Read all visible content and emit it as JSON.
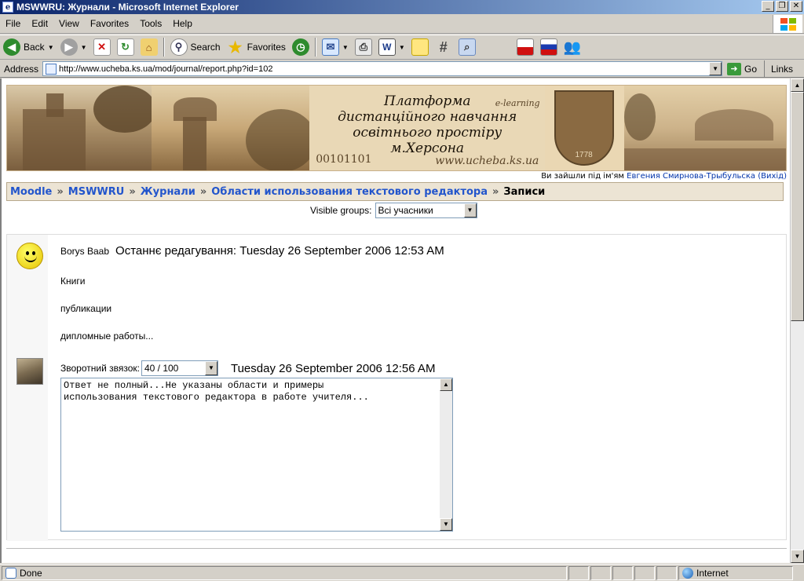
{
  "window": {
    "title": "MSWWRU: Журнали - Microsoft Internet Explorer"
  },
  "menu": [
    "File",
    "Edit",
    "View",
    "Favorites",
    "Tools",
    "Help"
  ],
  "toolbar": {
    "back_label": "Back",
    "search_label": "Search",
    "favorites_label": "Favorites"
  },
  "address": {
    "label": "Address",
    "url": "http://www.ucheba.ks.ua/mod/journal/report.php?id=102",
    "go_label": "Go",
    "links_label": "Links"
  },
  "banner": {
    "title_lines": [
      "Платформа",
      "дистанційного навчання",
      "освітнього простіру",
      "м.Херсона"
    ],
    "binary_text": "00101101",
    "url_text": "www.ucheba.ks.ua",
    "elearning_text": "e-learning",
    "crest_year": "1778"
  },
  "login": {
    "prefix": "Ви зайшли під ім'ям",
    "user": "Евгения Смирнова-Трыбульска",
    "logout": "(Вихід)"
  },
  "breadcrumb": {
    "items": [
      "Moodle",
      "MSWWRU",
      "Журнали",
      "Области использования текстового редактора"
    ],
    "current": "Записи",
    "separator": "»"
  },
  "groups": {
    "label": "Visible groups:",
    "selected": "Всі учасники"
  },
  "entry": {
    "author": "Borys Baab",
    "last_edit_label": "Останнє редагування:",
    "last_edit_date": "Tuesday 26 September 2006 12:53 AM",
    "lines": [
      "Книги",
      "публикации",
      "дипломные работы..."
    ],
    "feedback_label": "Зворотний звязок:",
    "grade": "40 / 100",
    "feedback_date": "Tuesday 26 September 2006 12:56 AM",
    "comment": "Ответ не полный...Не указаны области и примеры\nиспользования текстового редактора в работе учителя..."
  },
  "status": {
    "text": "Done",
    "zone": "Internet"
  }
}
